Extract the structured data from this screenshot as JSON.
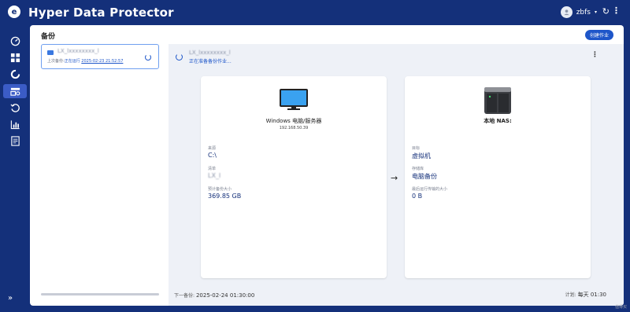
{
  "header": {
    "title": "Hyper Data Protector",
    "logo_letter": "e",
    "username": "zbfs",
    "avatar_icon": "user-icon",
    "refresh_icon": "refresh-icon",
    "more_icon": "more-vertical-icon"
  },
  "sidebar": {
    "items": [
      {
        "name": "dashboard",
        "icon": "gauge-icon"
      },
      {
        "name": "overview",
        "icon": "grid-icon"
      },
      {
        "name": "backup",
        "icon": "backup-ring-icon"
      },
      {
        "name": "jobs",
        "icon": "jobs-icon",
        "active": true
      },
      {
        "name": "restore",
        "icon": "restore-icon"
      },
      {
        "name": "reports",
        "icon": "chart-icon"
      },
      {
        "name": "logs",
        "icon": "log-icon"
      }
    ],
    "expand_glyph": "»"
  },
  "main": {
    "page_title": "备份",
    "create_job_label": "创建作业"
  },
  "job_list": {
    "items": [
      {
        "name": "LX_lxxxxxxxx_l",
        "last_label": "上次备份:",
        "status": "正在运行",
        "date": "2025-02-23 21:52:57"
      }
    ]
  },
  "detail": {
    "name": "LX_lxxxxxxxx_l",
    "status": "正在准备备份作业...",
    "source": {
      "title": "Windows 电脑/服务器",
      "ip": "192.168.50.39",
      "source_label": "来源",
      "source_value": "C:\\",
      "list_label": "清单",
      "list_value": "LX_l",
      "size_label": "预计备份大小",
      "size_value": "369.85 GB"
    },
    "arrow": "→",
    "destination": {
      "title": "本地 NAS:",
      "target_label": "目标",
      "target_value": "虚拟机",
      "storage_label": "存储库",
      "storage_value": "电脑备份",
      "transferred_label": "最后运行传输的大小",
      "transferred_value": "0 B"
    },
    "next_backup_label": "下一备份:",
    "next_backup_value": "2025-02-24 01:30:00",
    "schedule_label": "计划:",
    "schedule_value": "每天 01:30"
  },
  "watermark": "值得买"
}
